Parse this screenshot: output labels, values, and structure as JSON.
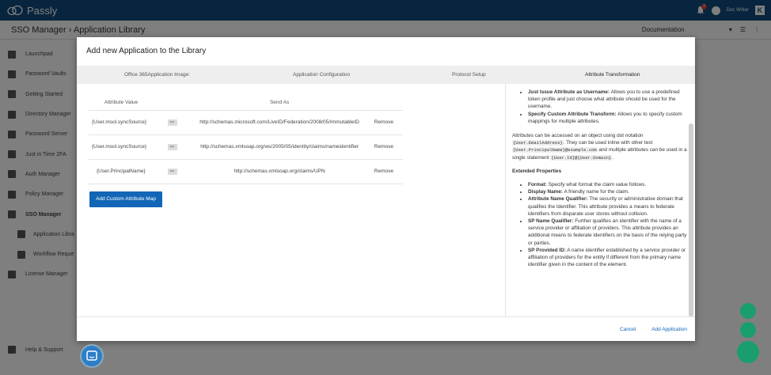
{
  "app": {
    "name": "Passly",
    "user": "Doc Writer",
    "notifications": "3",
    "logo_letter": "K"
  },
  "header": {
    "breadcrumb": "SSO Manager › Application Library",
    "dropdown": "Documentation"
  },
  "sidebar": {
    "items": [
      {
        "label": "Launchpad"
      },
      {
        "label": "Password Vaults"
      },
      {
        "label": "Getting Started"
      },
      {
        "label": "Directory Manager"
      },
      {
        "label": "Password Server"
      },
      {
        "label": "Just in Time 2FA"
      },
      {
        "label": "Auth Manager"
      },
      {
        "label": "Policy Manager"
      },
      {
        "label": "SSO Manager"
      },
      {
        "label": "Application Libra"
      },
      {
        "label": "Workflow Reque"
      },
      {
        "label": "License Manager"
      },
      {
        "label": "Help & Support"
      }
    ]
  },
  "modal": {
    "title": "Add new Application to the Library",
    "steps": [
      "Office 365Application Image:",
      "Application Configuration",
      "Protocol Setup",
      "Attribute Transformation"
    ],
    "table": {
      "headers": [
        "Attribute Value",
        "Send As"
      ],
      "arrow": "=>",
      "remove_label": "Remove",
      "rows": [
        {
          "value": "{User.msol.syncSource}",
          "send_as": "http://schemas.microsoft.com/LiveID/Federation/2008/05/ImmutableID"
        },
        {
          "value": "{User.msol.syncSource}",
          "send_as": "http://schemas.xmlsoap.org/ws/2005/05/identity/claims/nameidentifier"
        },
        {
          "value": "{User.PrincipalName}",
          "send_as": "http://schemas.xmlsoap.org/claims/UPN"
        }
      ]
    },
    "add_button": "Add Custom Attribute Map",
    "help": {
      "b1_title": "Just Issue Attribute as Username:",
      "b1_text": "Allows you to use a predefined token profile and just choose what attribute should be used for the username.",
      "b2_title": "Specify Custom Attribute Transform:",
      "b2_text": "Allows you to specify custom mappings for multiple attributes.",
      "p1a": "Attributes can be accessed on an object using dot notation",
      "p1_code1": "{User.EmailAddress}",
      "p1b": ". They can be used inline with other text",
      "p1_code2": "{User.PrincipalName}@example.com",
      "p1c": "and multiple attributes can be used in a single statement",
      "p1_code3": "{User.Id}@{User.Domain}",
      "p1d": ".",
      "ext_title": "Extended Properties",
      "e1_title": "Format:",
      "e1_text": "Specify what format the claim value follows.",
      "e2_title": "Display Name:",
      "e2_text": "A friendly name for the claim.",
      "e3_title": "Attribute Name Qualifier:",
      "e3_text": "The security or administrative domain that qualifies the Identifier. This attribute provides a means to federate identifiers from disparate user stores without collision.",
      "e4_title": "SP Name Qualifier:",
      "e4_text": "Further qualifies an identifier with the name of a service provider or affiliation of providers. This attribute provides an additional means to federate identifiers on the basis of the relying party or parties.",
      "e5_title": "SP Provided ID:",
      "e5_text": "A name identifier established by a service provider or affiliation of providers for the entity if different from the primary name identifier given in the content of the element."
    },
    "cancel": "Cancel",
    "submit": "Add Application"
  },
  "colors": {
    "topbar": "#0e4a7d",
    "primary": "#1366b6",
    "fab": "#1a9e6e"
  }
}
